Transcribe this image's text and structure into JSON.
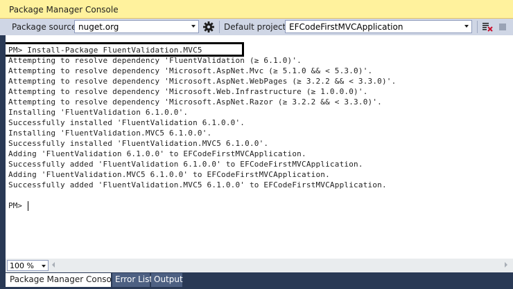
{
  "window": {
    "title": "Package Manager Console"
  },
  "toolbar": {
    "package_source_label": "Package source:",
    "package_source_value": "nuget.org",
    "default_project_label": "Default project:",
    "default_project_value": "EFCodeFirstMVCApplication",
    "icons": [
      "settings-gear-icon",
      "clear-console-icon",
      "stop-icon"
    ]
  },
  "console": {
    "lines": [
      "PM> Install-Package FluentValidation.MVC5",
      "Attempting to resolve dependency 'FluentValidation (≥ 6.1.0)'.",
      "Attempting to resolve dependency 'Microsoft.AspNet.Mvc (≥ 5.1.0 && < 5.3.0)'.",
      "Attempting to resolve dependency 'Microsoft.AspNet.WebPages (≥ 3.2.2 && < 3.3.0)'.",
      "Attempting to resolve dependency 'Microsoft.Web.Infrastructure (≥ 1.0.0.0)'.",
      "Attempting to resolve dependency 'Microsoft.AspNet.Razor (≥ 3.2.2 && < 3.3.0)'.",
      "Installing 'FluentValidation 6.1.0.0'.",
      "Successfully installed 'FluentValidation 6.1.0.0'.",
      "Installing 'FluentValidation.MVC5 6.1.0.0'.",
      "Successfully installed 'FluentValidation.MVC5 6.1.0.0'.",
      "Adding 'FluentValidation 6.1.0.0' to EFCodeFirstMVCApplication.",
      "Successfully added 'FluentValidation 6.1.0.0' to EFCodeFirstMVCApplication.",
      "Adding 'FluentValidation.MVC5 6.1.0.0' to EFCodeFirstMVCApplication.",
      "Successfully added 'FluentValidation.MVC5 6.1.0.0' to EFCodeFirstMVCApplication."
    ],
    "prompt": "PM> "
  },
  "zoom": {
    "value": "100 %"
  },
  "tabs": [
    {
      "label": "Package Manager Console",
      "active": true
    },
    {
      "label": "Error List",
      "active": false
    },
    {
      "label": "Output",
      "active": false
    }
  ],
  "colors": {
    "title_bar": "#FFF29D",
    "toolbar": "#CFD6E5",
    "chrome": "#293955",
    "console_bg": "#FFFFFF"
  }
}
